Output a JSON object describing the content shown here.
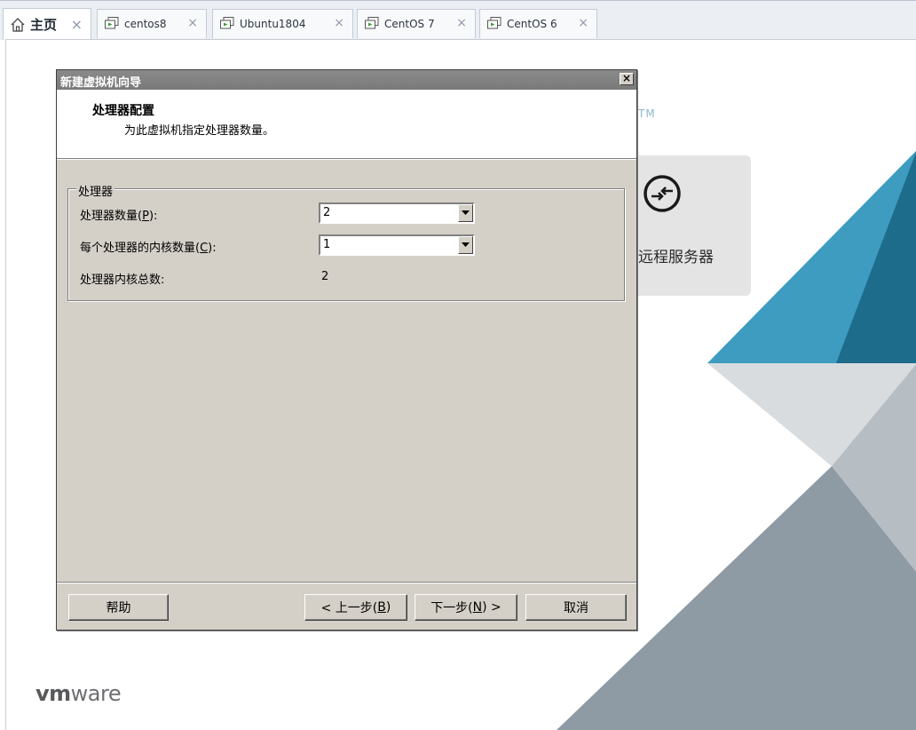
{
  "tabs": [
    {
      "label": "主页",
      "icon": "home-icon",
      "active": true
    },
    {
      "label": "centos8",
      "icon": "vm-icon",
      "active": false
    },
    {
      "label": "Ubuntu1804",
      "icon": "vm-icon",
      "active": false
    },
    {
      "label": "CentOS 7",
      "icon": "vm-icon",
      "active": false
    },
    {
      "label": "CentOS 6",
      "icon": "vm-icon",
      "active": false
    }
  ],
  "tab_close_glyph": "×",
  "home": {
    "tm_mark": "TM",
    "remote_server_label": "远程服务器",
    "logo_vm": "vm",
    "logo_ware": "ware"
  },
  "dialog": {
    "title": "新建虚拟机向导",
    "close_glyph": "×",
    "header_title": "处理器配置",
    "header_subtitle": "为此虚拟机指定处理器数量。",
    "group_label": "处理器",
    "processor_count": {
      "label": "处理器数量",
      "hotkey": "P",
      "value": "2"
    },
    "cores_per_processor": {
      "label": "每个处理器的内核数量",
      "hotkey": "C",
      "value": "1"
    },
    "total_cores": {
      "label": "处理器内核总数:",
      "value": "2"
    },
    "buttons": {
      "help": "帮助",
      "back_prefix": "< 上一步(",
      "back_hotkey": "B",
      "back_suffix": ")",
      "next_prefix": "下一步(",
      "next_hotkey": "N",
      "next_suffix": ") >",
      "cancel": "取消"
    }
  },
  "colors": {
    "accent_blue": "#4aa3c4",
    "dark_blue": "#1f6f8f",
    "art_gray": "#8e9aa4",
    "dialog_bg": "#d4d0c8"
  }
}
